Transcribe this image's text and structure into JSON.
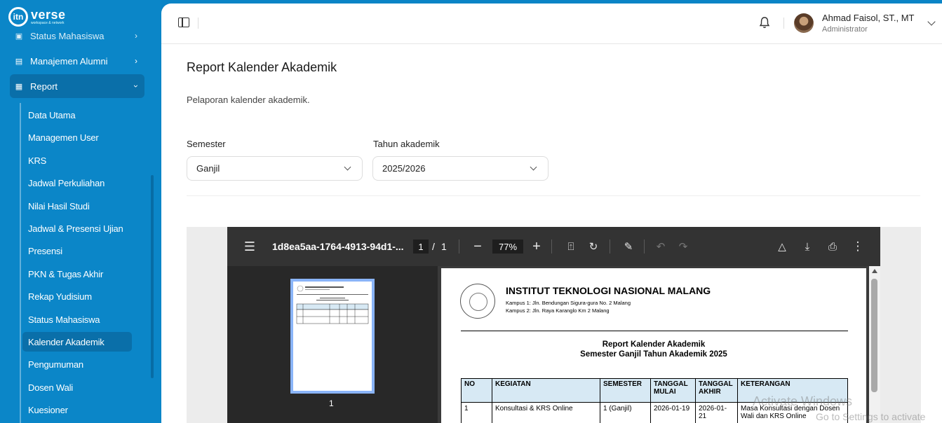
{
  "app": {
    "logo_mark": "itn",
    "logo_name": "verse",
    "logo_sub": "workspace & network"
  },
  "sidebar": {
    "top_items": [
      {
        "label": "Status Mahasiswa",
        "icon": "user-status-icon"
      },
      {
        "label": "Manajemen Alumni",
        "icon": "alumni-icon"
      },
      {
        "label": "Report",
        "icon": "report-icon"
      }
    ],
    "report_items": [
      {
        "label": "Data Utama"
      },
      {
        "label": "Managemen User"
      },
      {
        "label": "KRS"
      },
      {
        "label": "Jadwal Perkuliahan"
      },
      {
        "label": "Nilai Hasil Studi"
      },
      {
        "label": "Jadwal & Presensi Ujian"
      },
      {
        "label": "Presensi"
      },
      {
        "label": "PKN & Tugas Akhir"
      },
      {
        "label": "Rekap Yudisium"
      },
      {
        "label": "Status Mahasiswa"
      },
      {
        "label": "Kalender Akademik"
      },
      {
        "label": "Pengumuman"
      },
      {
        "label": "Dosen Wali"
      },
      {
        "label": "Kuesioner"
      }
    ],
    "active_item": "Kalender Akademik"
  },
  "header": {
    "user_name": "Ahmad Faisol, ST., MT",
    "user_role": "Administrator"
  },
  "page": {
    "title": "Report Kalender Akademik",
    "description": "Pelaporan kalender akademik."
  },
  "filters": {
    "semester_label": "Semester",
    "semester_value": "Ganjil",
    "year_label": "Tahun akademik",
    "year_value": "2025/2026"
  },
  "pdf_viewer": {
    "file_name": "1d8ea5aa-1764-4913-94d1-...",
    "current_page": "1",
    "page_sep": "/",
    "total_pages": "1",
    "zoom": "77%",
    "thumb_number": "1"
  },
  "document": {
    "institution": "INSTITUT TEKNOLOGI NASIONAL MALANG",
    "campus1": "Kampus 1: Jln. Bendungan Sigura-gura No. 2 Malang",
    "campus2": "Kampus 2: Jln. Raya Karanglo Km 2 Malang",
    "title1": "Report Kalender Akademik",
    "title2": "Semester Ganjil Tahun Akademik 2025",
    "columns": [
      "NO",
      "KEGIATAN",
      "SEMESTER",
      "TANGGAL MULAI",
      "TANGGAL AKHIR",
      "KETERANGAN"
    ],
    "rows": [
      [
        "1",
        "Konsultasi & KRS Online",
        "1 (Ganjil)",
        "2026-01-19",
        "2026-01-21",
        "Masa Konsultasi dengan Dosen Wali dan KRS Online"
      ]
    ]
  },
  "watermark": {
    "line1": "Activate Windows",
    "line2": "Go to Settings to activate Windows."
  }
}
